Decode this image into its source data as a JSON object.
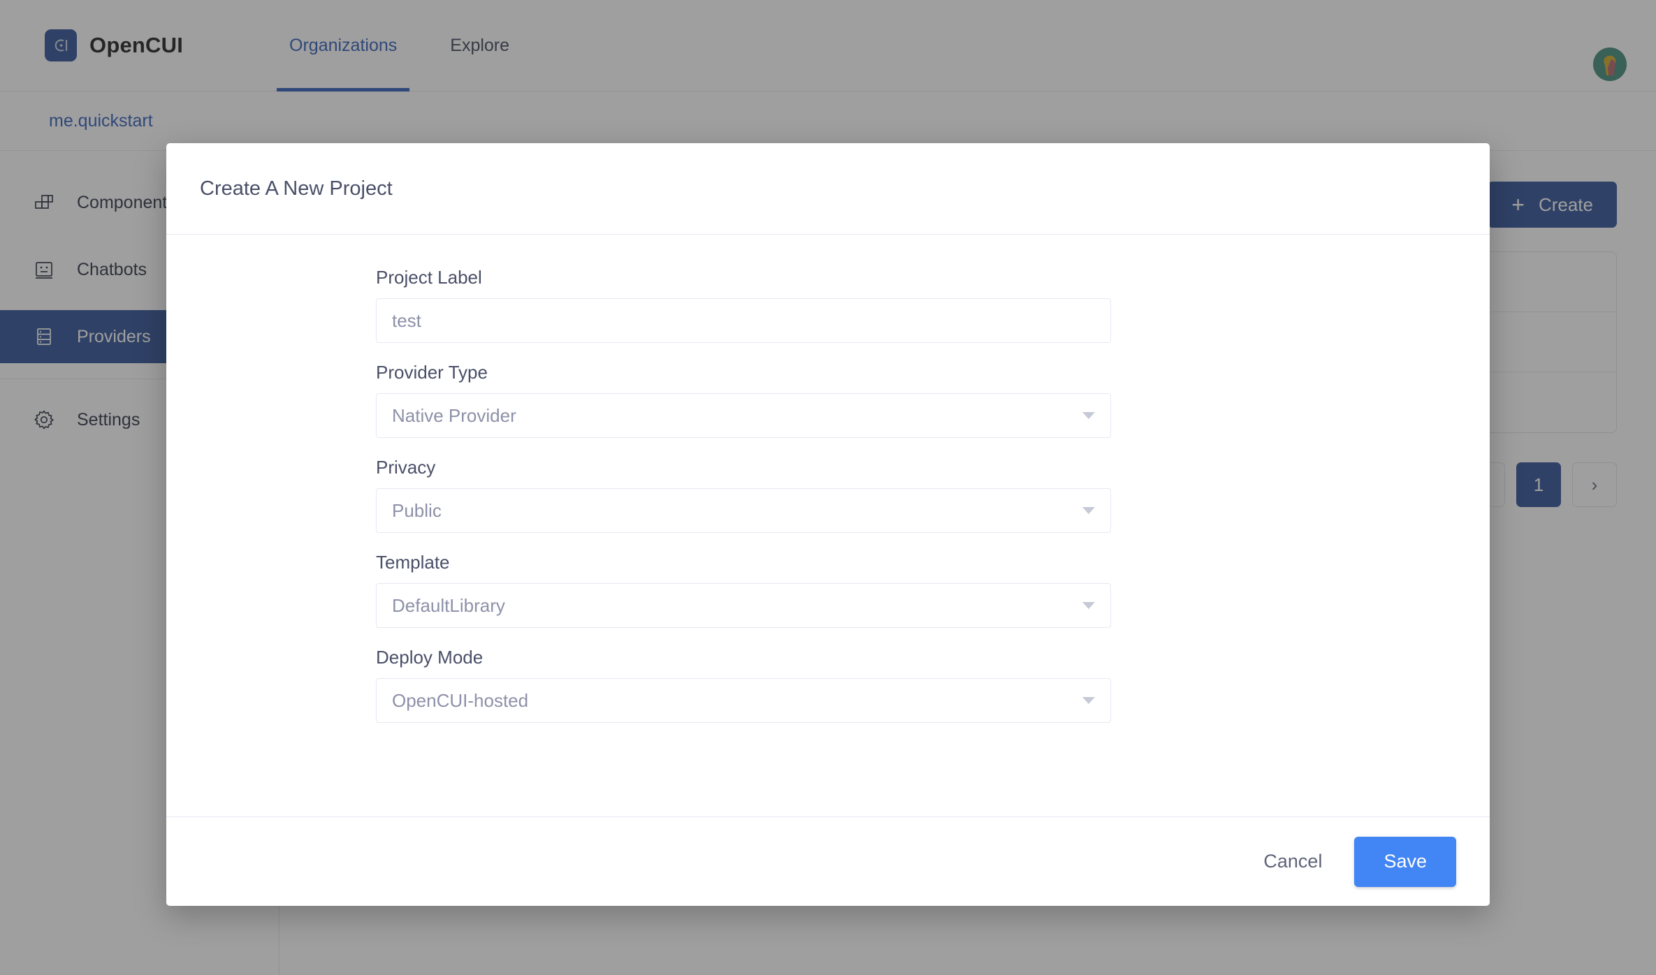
{
  "header": {
    "brand_name": "OpenCUI",
    "logo_icon": "opencui-logo-icon",
    "nav": [
      {
        "label": "Organizations",
        "active": true
      },
      {
        "label": "Explore",
        "active": false
      }
    ],
    "avatar_icon": "user-avatar"
  },
  "breadcrumb": {
    "items": [
      {
        "label": "me.quickstart"
      }
    ]
  },
  "sidebar": {
    "items": [
      {
        "label": "Components",
        "icon": "blocks-icon",
        "active": false
      },
      {
        "label": "Chatbots",
        "icon": "robot-face-icon",
        "active": false
      },
      {
        "label": "Providers",
        "icon": "server-stack-icon",
        "active": true
      },
      {
        "label": "Settings",
        "icon": "gear-icon",
        "active": false
      }
    ]
  },
  "content": {
    "create_button": {
      "label": "Create",
      "icon": "plus-icon"
    },
    "list_rows": [
      "",
      "",
      ""
    ],
    "pagination": {
      "prev_label": "‹",
      "next_label": "›",
      "pages": [
        "1"
      ],
      "current": "1"
    }
  },
  "modal": {
    "title": "Create A New Project",
    "fields": [
      {
        "label": "Project Label",
        "type": "text",
        "value": "test",
        "placeholder": "test",
        "name": "project-label-input"
      },
      {
        "label": "Provider Type",
        "type": "select",
        "value": "Native Provider",
        "name": "provider-type-select"
      },
      {
        "label": "Privacy",
        "type": "select",
        "value": "Public",
        "name": "privacy-select"
      },
      {
        "label": "Template",
        "type": "select",
        "value": "DefaultLibrary",
        "name": "template-select"
      },
      {
        "label": "Deploy Mode",
        "type": "select",
        "value": "OpenCUI-hosted",
        "name": "deploy-mode-select"
      }
    ],
    "cancel_label": "Cancel",
    "save_label": "Save"
  },
  "colors": {
    "brand_blue": "#2d4f93",
    "link_blue": "#2f5bb7",
    "save_blue": "#4285f4",
    "label_slate": "#4a4f68",
    "value_gray": "#8d91a8",
    "border": "#e7e7f2"
  }
}
